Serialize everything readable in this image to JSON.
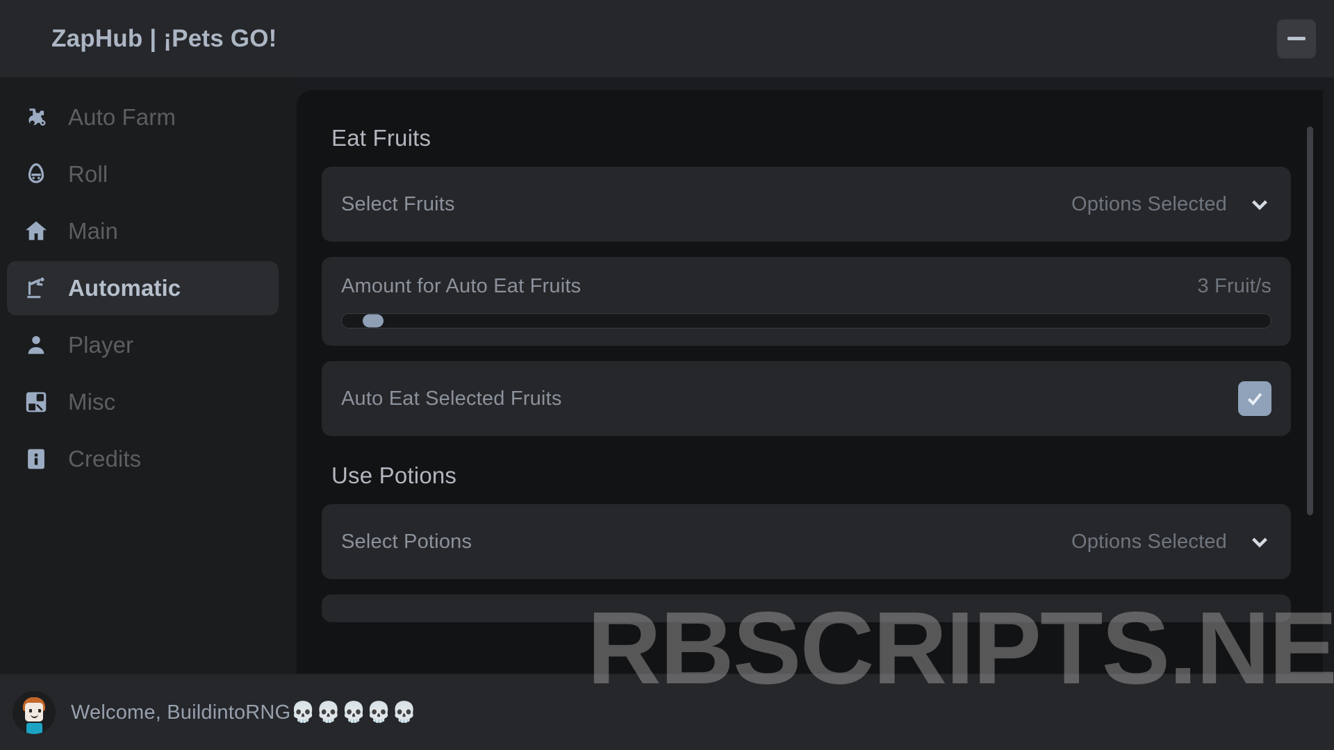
{
  "window": {
    "title": "ZapHub | ¡Pets GO!",
    "minimize_label": "—"
  },
  "sidebar": {
    "items": [
      {
        "label": "Auto Farm",
        "icon": "tractor-icon",
        "active": false
      },
      {
        "label": "Roll",
        "icon": "egg-icon",
        "active": false
      },
      {
        "label": "Main",
        "icon": "home-icon",
        "active": false
      },
      {
        "label": "Automatic",
        "icon": "robot-arm-icon",
        "active": true
      },
      {
        "label": "Player",
        "icon": "person-icon",
        "active": false
      },
      {
        "label": "Misc",
        "icon": "dashboard-icon",
        "active": false
      },
      {
        "label": "Credits",
        "icon": "info-icon",
        "active": false
      }
    ]
  },
  "content": {
    "sections": [
      {
        "title": "Eat Fruits",
        "rows": [
          {
            "type": "dropdown",
            "label": "Select Fruits",
            "value": "Options Selected",
            "icon": "chevron-down-icon"
          },
          {
            "type": "slider",
            "label": "Amount for Auto Eat Fruits",
            "value": "3 Fruit/s",
            "percent": 2
          },
          {
            "type": "checkbox",
            "label": "Auto Eat Selected Fruits",
            "checked": true,
            "icon": "check-icon"
          }
        ]
      },
      {
        "title": "Use Potions",
        "rows": [
          {
            "type": "dropdown",
            "label": "Select Potions",
            "value": "Options Selected",
            "icon": "chevron-down-icon"
          }
        ]
      }
    ]
  },
  "userbar": {
    "welcome": "Welcome, BuildintoRNG💀💀💀💀💀",
    "avatar_alt": "roblox-avatar"
  },
  "watermark": {
    "text": "RBSCRIPTS.NET"
  },
  "colors": {
    "accent": "#8fa2ba",
    "titlebar": "#26272b",
    "panel": "#121315",
    "card": "#26272a",
    "active_nav": "#2b2c30"
  }
}
